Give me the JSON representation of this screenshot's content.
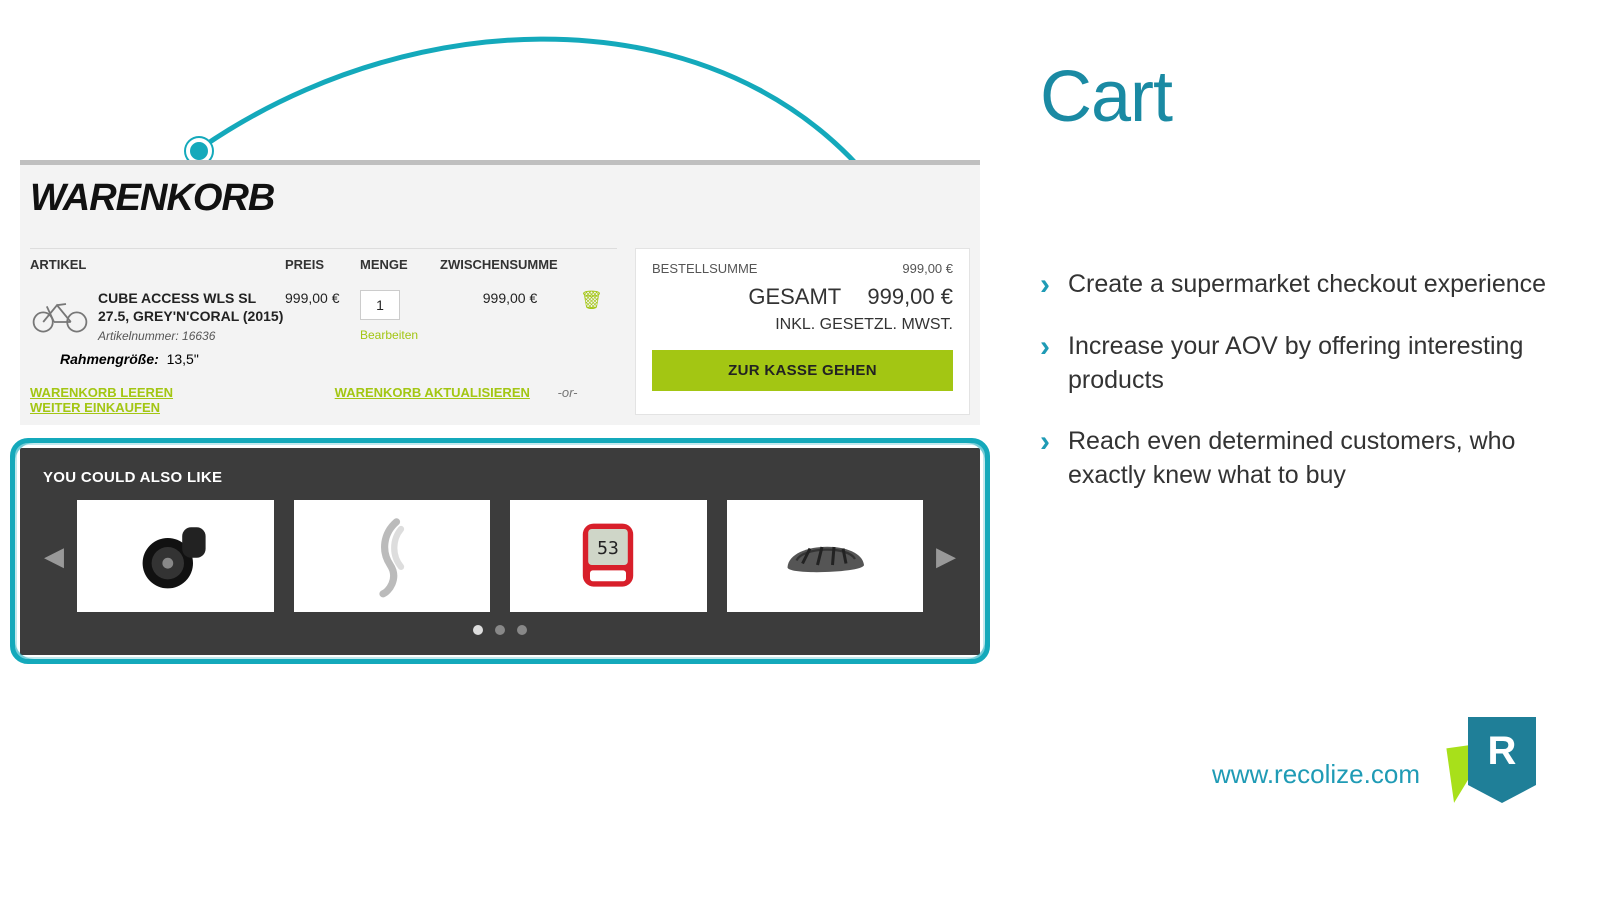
{
  "slide": {
    "title": "Cart",
    "bullets": [
      "Create a supermarket checkout experience",
      "Increase your AOV by offering interesting products",
      "Reach even determined customers, who exactly knew what to buy"
    ],
    "brand_url": "www.recolize.com",
    "brand_letter": "R"
  },
  "screenshot": {
    "heading": "WARENKORB",
    "columns": {
      "article": "ARTIKEL",
      "price": "PREIS",
      "qty": "MENGE",
      "subtotal": "ZWISCHENSUMME"
    },
    "item": {
      "name": "CUBE ACCESS WLS SL 27.5, GREY'N'CORAL (2015)",
      "sku_label": "Artikelnummer:",
      "sku": "16636",
      "frame_label": "Rahmengröße:",
      "frame_value": "13,5\"",
      "price": "999,00 €",
      "qty": "1",
      "subtotal": "999,00 €",
      "edit": "Bearbeiten"
    },
    "summary": {
      "order_sum_label": "BESTELLSUMME",
      "order_sum_value": "999,00 €",
      "total_label": "GESAMT",
      "total_value": "999,00 €",
      "tax_note": "INKL. GESETZL. MWST.",
      "checkout_btn": "ZUR KASSE GEHEN"
    },
    "links": {
      "empty": "WARENKORB LEEREN",
      "update": "WARENKORB AKTUALISIEREN",
      "sep": "-or-",
      "continue": "WEITER EINKAUFEN"
    },
    "reco": {
      "title": "YOU COULD ALSO LIKE",
      "products": [
        "bike-bell",
        "bottle-cage",
        "bike-computer",
        "bike-helmet"
      ],
      "dot_count": 3,
      "active_dot": 0
    }
  }
}
